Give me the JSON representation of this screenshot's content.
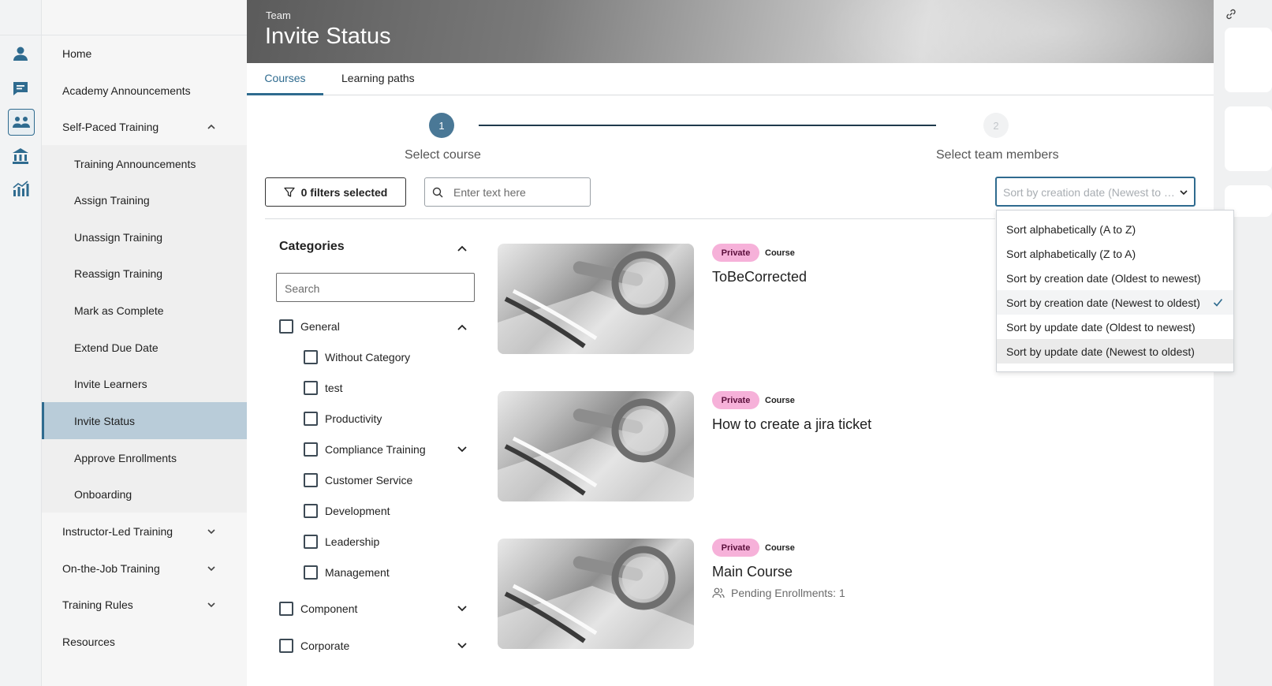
{
  "banner": {
    "kicker": "Team",
    "title": "Invite Status"
  },
  "rail": {
    "icons": [
      "person-icon",
      "chat-icon",
      "team-icon",
      "institution-icon",
      "analytics-icon"
    ]
  },
  "sidebar": {
    "items": [
      {
        "label": "Home",
        "level": 1
      },
      {
        "label": "Academy Announcements",
        "level": 1
      },
      {
        "label": "Self-Paced Training",
        "level": 1,
        "expanded": true
      },
      {
        "label": "Training Announcements",
        "level": 2
      },
      {
        "label": "Assign Training",
        "level": 2
      },
      {
        "label": "Unassign Training",
        "level": 2
      },
      {
        "label": "Reassign Training",
        "level": 2
      },
      {
        "label": "Mark as Complete",
        "level": 2
      },
      {
        "label": "Extend Due Date",
        "level": 2
      },
      {
        "label": "Invite Learners",
        "level": 2
      },
      {
        "label": "Invite Status",
        "level": 2,
        "active": true
      },
      {
        "label": "Approve Enrollments",
        "level": 2
      },
      {
        "label": "Onboarding",
        "level": 2
      },
      {
        "label": "Instructor-Led Training",
        "level": 1,
        "expanded": false
      },
      {
        "label": "On-the-Job Training",
        "level": 1,
        "expanded": false
      },
      {
        "label": "Training Rules",
        "level": 1,
        "expanded": false
      },
      {
        "label": "Resources",
        "level": 1
      }
    ]
  },
  "tabs": [
    {
      "label": "Courses",
      "active": true
    },
    {
      "label": "Learning paths",
      "active": false
    }
  ],
  "stepper": {
    "steps": [
      {
        "number": "1",
        "label": "Select course",
        "active": true
      },
      {
        "number": "2",
        "label": "Select team members",
        "active": false
      }
    ]
  },
  "toolbar": {
    "filters_label": "0 filters selected",
    "search_placeholder": "Enter text here",
    "sort_value": "Sort by creation date (Newest to o..."
  },
  "sort_menu": {
    "options": [
      {
        "label": "Sort alphabetically (A to Z)"
      },
      {
        "label": "Sort alphabetically (Z to A)"
      },
      {
        "label": "Sort by creation date (Oldest to newest)"
      },
      {
        "label": "Sort by creation date (Newest to oldest)",
        "selected": true
      },
      {
        "label": "Sort by update date (Oldest to newest)"
      },
      {
        "label": "Sort by update date (Newest to oldest)",
        "hover": true
      }
    ]
  },
  "categories": {
    "title": "Categories",
    "search_placeholder": "Search",
    "items": [
      {
        "label": "General",
        "level": 1,
        "expanded": true
      },
      {
        "label": "Without Category",
        "level": 2
      },
      {
        "label": "test",
        "level": 2
      },
      {
        "label": "Productivity",
        "level": 2
      },
      {
        "label": "Compliance Training",
        "level": 2,
        "expandable": true
      },
      {
        "label": "Customer Service",
        "level": 2
      },
      {
        "label": "Development",
        "level": 2
      },
      {
        "label": "Leadership",
        "level": 2
      },
      {
        "label": "Management",
        "level": 2
      },
      {
        "label": "Component",
        "level": 1,
        "expandable": true
      },
      {
        "label": "Corporate",
        "level": 1,
        "expandable": true
      }
    ]
  },
  "courses": [
    {
      "badge": "Private",
      "type": "Course",
      "title": "ToBeCorrected"
    },
    {
      "badge": "Private",
      "type": "Course",
      "title": "How to create a jira ticket"
    },
    {
      "badge": "Private",
      "type": "Course",
      "title": "Main Course",
      "pending": "Pending Enrollments: 1"
    }
  ],
  "colors": {
    "accent": "#2f6b8f",
    "active_nav_bg": "#b9ccd9",
    "private_badge_bg": "#f6b1d9"
  }
}
